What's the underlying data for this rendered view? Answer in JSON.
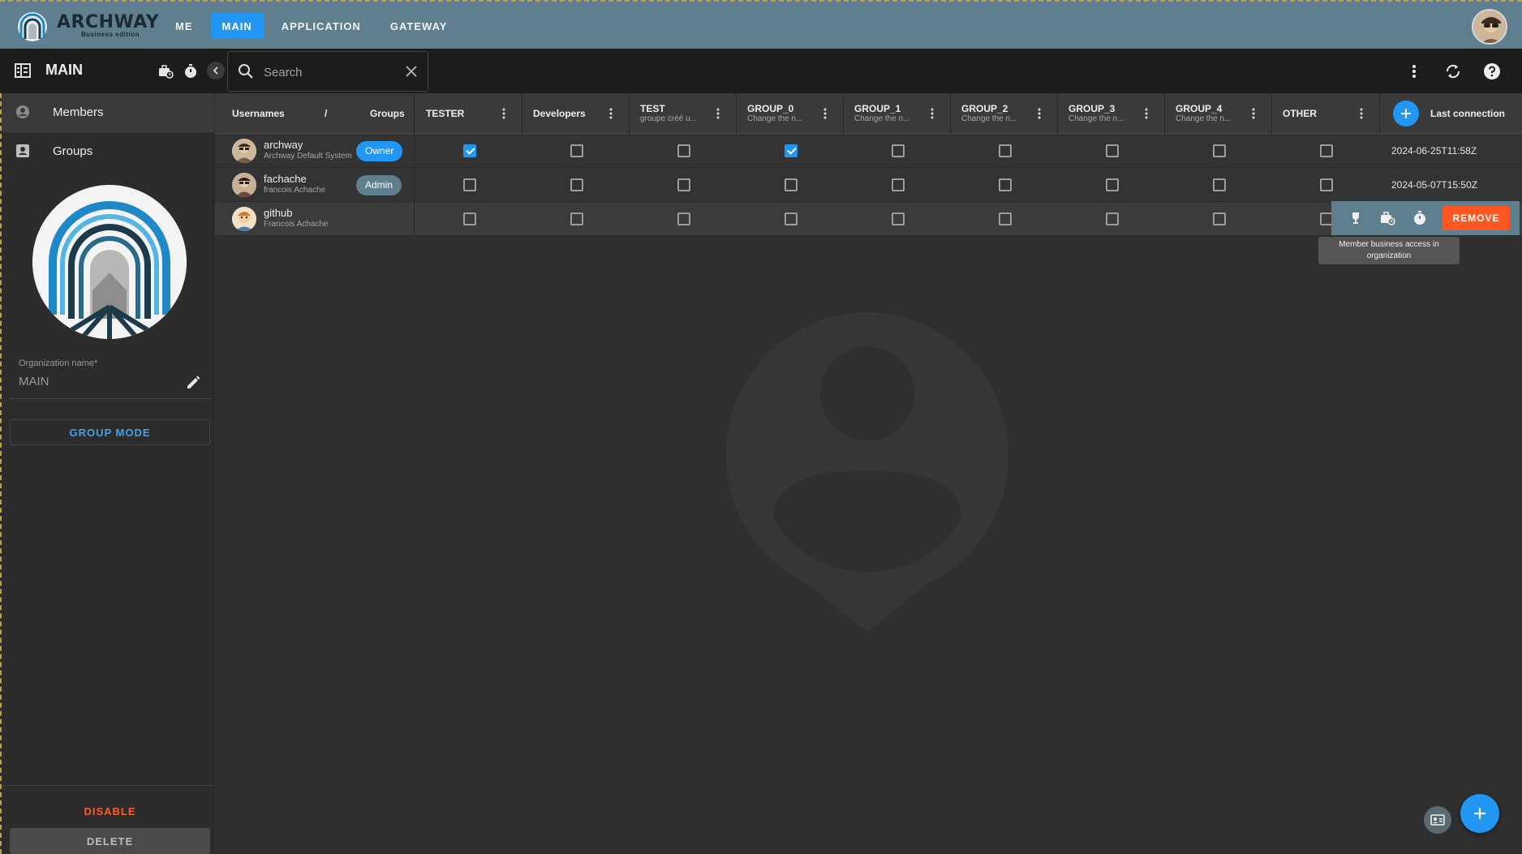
{
  "brand": {
    "name": "ARCHWAY",
    "edition": "Business edition"
  },
  "nav": {
    "tabs": [
      {
        "label": "ME",
        "active": false
      },
      {
        "label": "MAIN",
        "active": true
      },
      {
        "label": "APPLICATION",
        "active": false
      },
      {
        "label": "GATEWAY",
        "active": false
      }
    ]
  },
  "org": {
    "title": "MAIN",
    "name_label": "Organization name*",
    "name_value": "MAIN"
  },
  "search": {
    "placeholder": "Search",
    "value": ""
  },
  "sidebar": {
    "items": [
      {
        "label": "Members",
        "icon": "account-circle-icon",
        "active": true
      },
      {
        "label": "Groups",
        "icon": "account-box-icon",
        "active": false
      }
    ]
  },
  "buttons": {
    "group_mode": "GROUP MODE",
    "disable": "DISABLE",
    "delete": "DELETE",
    "remove": "REMOVE"
  },
  "table": {
    "user_col": {
      "usernames": "Usernames",
      "slash": "/",
      "groups": "Groups"
    },
    "groups": [
      {
        "name": "TESTER",
        "desc": ""
      },
      {
        "name": "Developers",
        "desc": ""
      },
      {
        "name": "TEST",
        "desc": "groupe créé u..."
      },
      {
        "name": "GROUP_0",
        "desc": "Change the n..."
      },
      {
        "name": "GROUP_1",
        "desc": "Change the n..."
      },
      {
        "name": "GROUP_2",
        "desc": "Change the n..."
      },
      {
        "name": "GROUP_3",
        "desc": "Change the n..."
      },
      {
        "name": "GROUP_4",
        "desc": "Change the n..."
      },
      {
        "name": "OTHER",
        "desc": ""
      }
    ],
    "last_connection_label": "Last connection",
    "rows": [
      {
        "username": "archway",
        "description": "Archway Default System",
        "role": "Owner",
        "checks": [
          true,
          false,
          false,
          true,
          false,
          false,
          false,
          false,
          false
        ],
        "last_connection": "2024-06-25T11:58Z"
      },
      {
        "username": "fachache",
        "description": "francois Achache",
        "role": "Admin",
        "checks": [
          false,
          false,
          false,
          false,
          false,
          false,
          false,
          false,
          false
        ],
        "last_connection": "2024-05-07T15:50Z"
      },
      {
        "username": "github",
        "description": "Francois Achache",
        "role": "",
        "checks": [
          false,
          false,
          false,
          false,
          false,
          false,
          false,
          false,
          false
        ],
        "last_connection": ""
      }
    ]
  },
  "tooltip": {
    "text": "Member business access in organization"
  },
  "colors": {
    "accent": "#2196f3",
    "topbar": "#5f7f8f",
    "danger": "#ff5722",
    "background": "#2f2f2f"
  }
}
